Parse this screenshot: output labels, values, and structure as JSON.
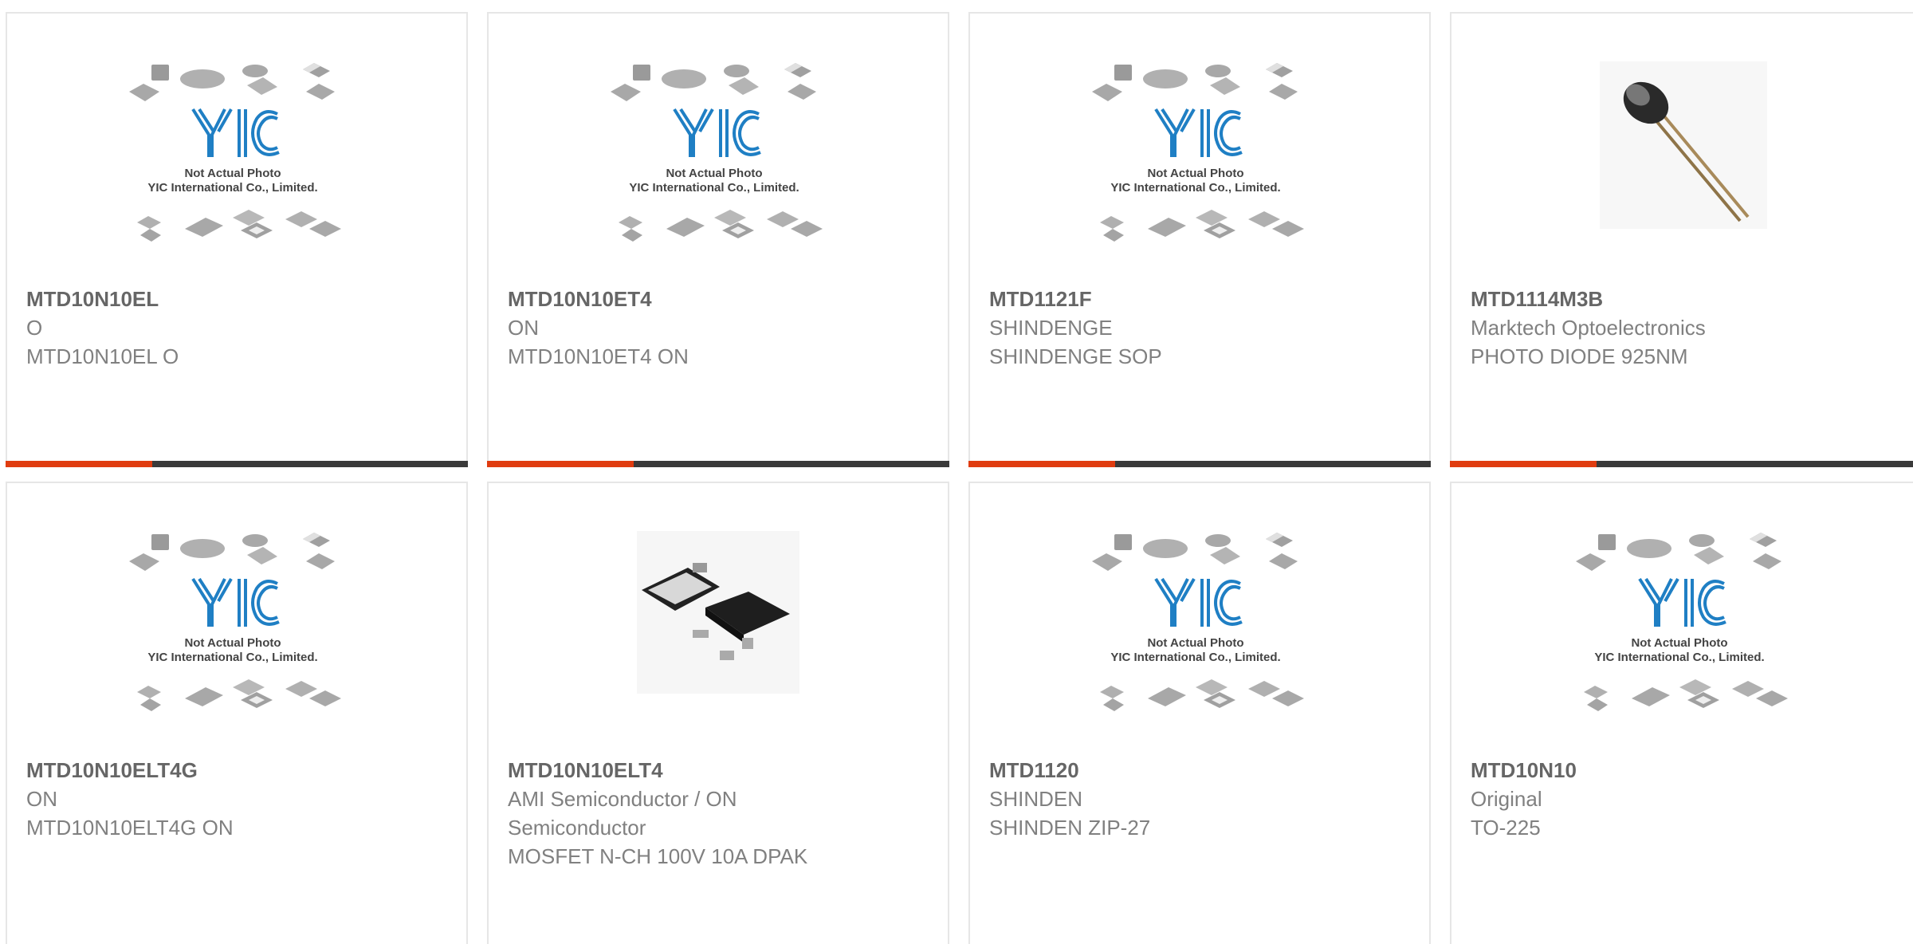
{
  "products": [
    {
      "part": "MTD10N10EL",
      "line1": "O",
      "line2": "MTD10N10EL O",
      "line3": "",
      "image": "placeholder-logo",
      "placeholder_text": [
        "Not Actual Photo",
        "YIC International Co., Limited."
      ]
    },
    {
      "part": "MTD10N10ET4",
      "line1": "ON",
      "line2": "MTD10N10ET4 ON",
      "line3": "",
      "image": "placeholder-logo",
      "placeholder_text": [
        "Not Actual Photo",
        "YIC International Co., Limited."
      ]
    },
    {
      "part": "MTD1121F",
      "line1": "SHINDENGE",
      "line2": "SHINDENGE SOP",
      "line3": "",
      "image": "placeholder-logo",
      "placeholder_text": [
        "Not Actual Photo",
        "YIC International Co., Limited."
      ]
    },
    {
      "part": "MTD1114M3B",
      "line1": "Marktech Optoelectronics",
      "line2": "PHOTO DIODE 925NM",
      "line3": "",
      "image": "photodiode-photo"
    },
    {
      "part": "MTD10N10ELT4G",
      "line1": "ON",
      "line2": "MTD10N10ELT4G ON",
      "line3": "",
      "image": "placeholder-logo",
      "placeholder_text": [
        "Not Actual Photo",
        "YIC International Co., Limited."
      ]
    },
    {
      "part": "MTD10N10ELT4",
      "line1": "AMI Semiconductor / ON",
      "line2": "Semiconductor",
      "line3": "MOSFET N-CH 100V 10A DPAK",
      "image": "dpak-photo"
    },
    {
      "part": "MTD1120",
      "line1": "SHINDEN",
      "line2": "SHINDEN ZIP-27",
      "line3": "",
      "image": "placeholder-logo",
      "placeholder_text": [
        "Not Actual Photo",
        "YIC International Co., Limited."
      ]
    },
    {
      "part": "MTD10N10",
      "line1": "Original",
      "line2": "TO-225",
      "line3": "",
      "image": "placeholder-logo",
      "placeholder_text": [
        "Not Actual Photo",
        "YIC International Co., Limited."
      ]
    }
  ],
  "colors": {
    "accent": "#e03c10",
    "bar": "#3a3a3a",
    "logo": "#1f7fc4",
    "text": "#808080",
    "title": "#666666"
  }
}
